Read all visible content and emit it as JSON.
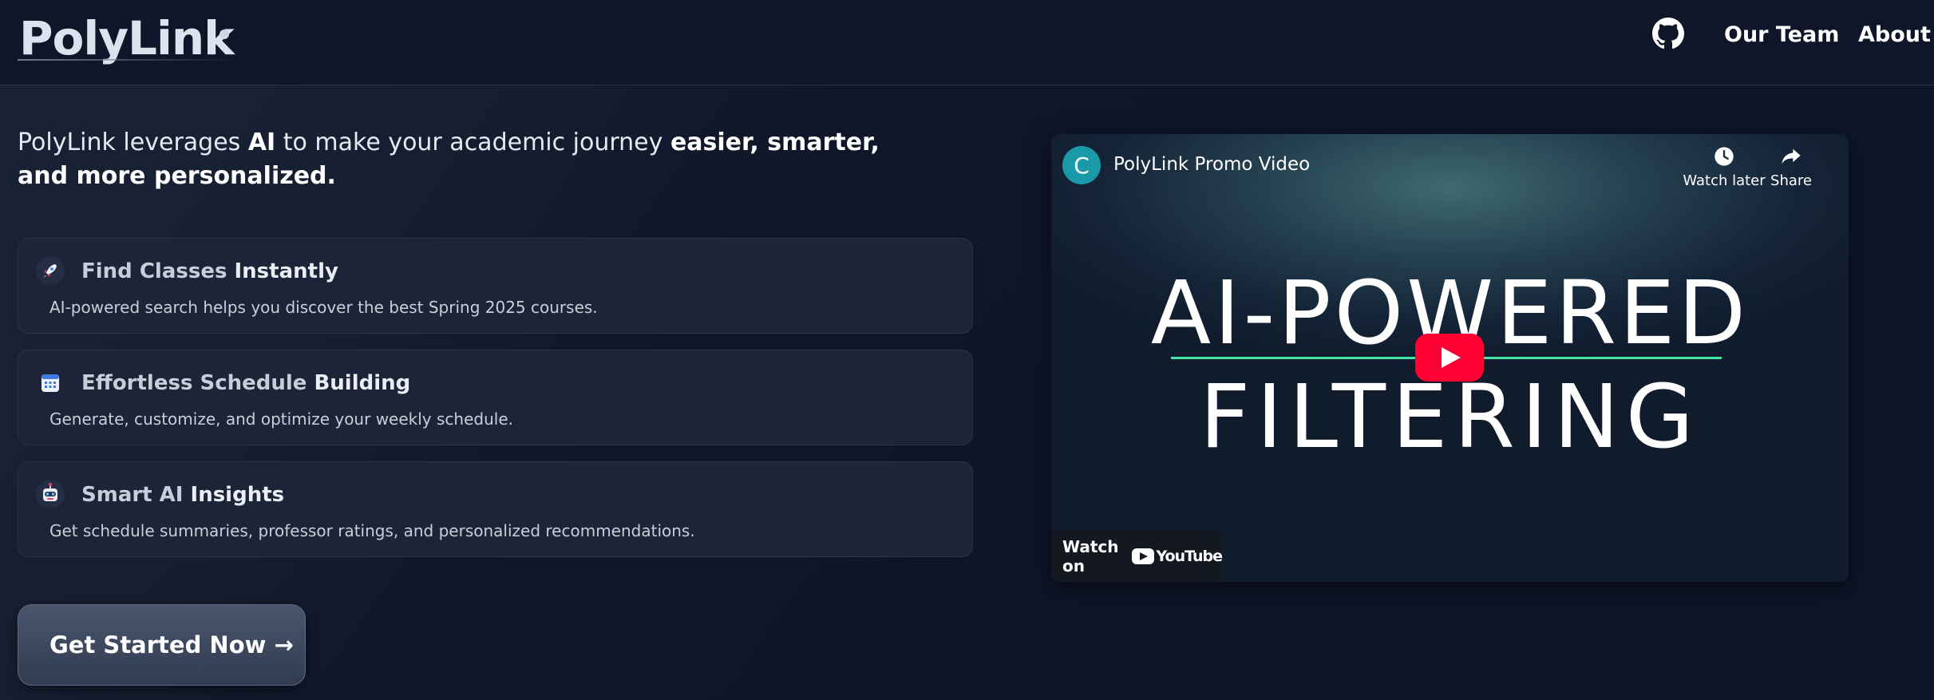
{
  "header": {
    "logo": "PolyLink",
    "nav": [
      {
        "label": "Our Team"
      },
      {
        "label": "About"
      }
    ],
    "github_icon": "github-icon"
  },
  "intro": {
    "part1": "PolyLink leverages ",
    "ai": "AI",
    "part2": " to make your academic journey ",
    "emph": "easier, smarter, and more personalized."
  },
  "features": [
    {
      "icon": "rocket-icon",
      "title_dim": "Find Classes ",
      "title_hi": "Instantly",
      "desc": "AI-powered search helps you discover the best Spring 2025 courses."
    },
    {
      "icon": "calendar-icon",
      "title_dim": "Effortless Schedule ",
      "title_hi": "Building",
      "desc": "Generate, customize, and optimize your weekly schedule."
    },
    {
      "icon": "robot-icon",
      "title_dim": "Smart AI ",
      "title_hi": "Insights",
      "desc": "Get schedule summaries, professor ratings, and personalized recommendations."
    }
  ],
  "cta": {
    "label": "Get Started Now →"
  },
  "video": {
    "channel_initial": "C",
    "title": "PolyLink Promo Video",
    "watch_later": "Watch later",
    "share": "Share",
    "headline_1": "AI-POWERED",
    "headline_2": "FILTERING",
    "watch_on": "Watch on",
    "youtube": "YouTube"
  },
  "colors": {
    "background": "#0e1528",
    "card": "#1d2437",
    "accent_green": "#3fe6a6",
    "play_red": "#ff0033"
  }
}
